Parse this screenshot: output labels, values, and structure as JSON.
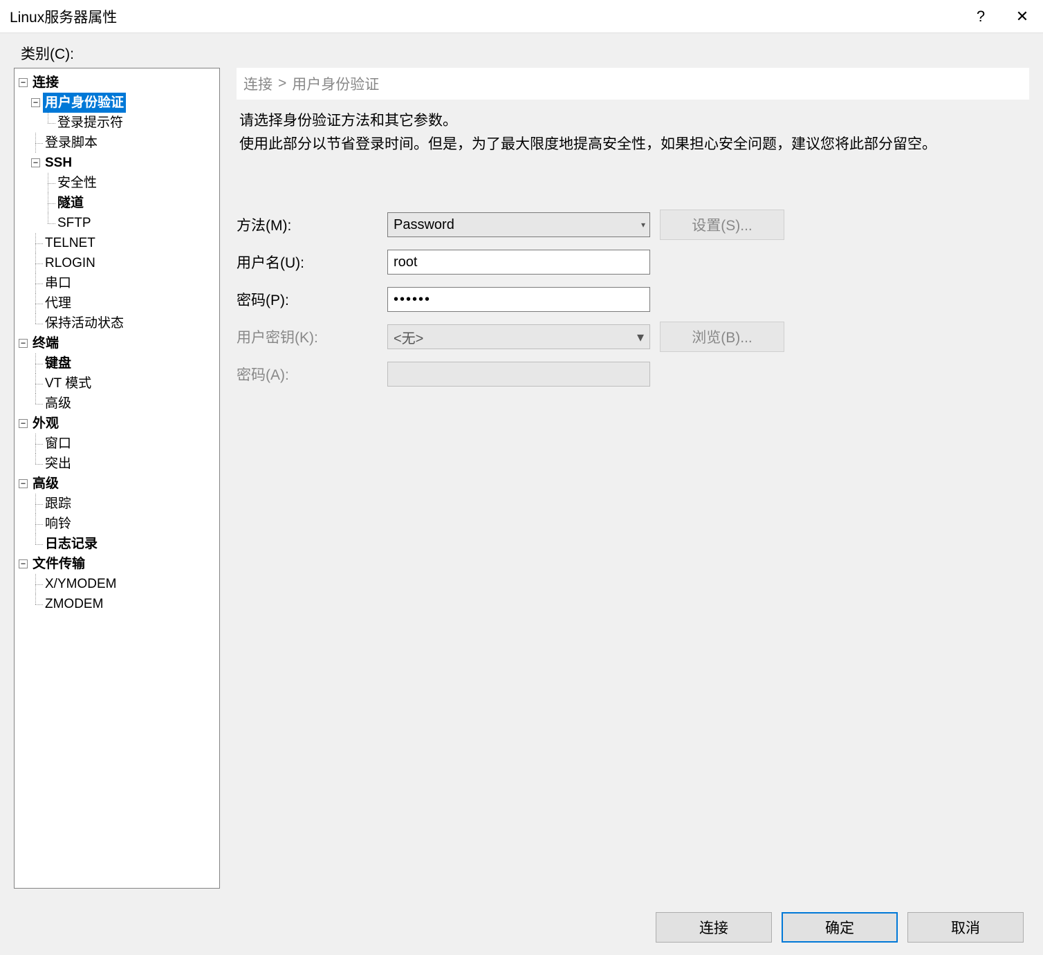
{
  "window": {
    "title": "Linux服务器属性"
  },
  "titlebar": {
    "help": "?",
    "close": "✕"
  },
  "category_label": "类别(C):",
  "tree": {
    "connection": "连接",
    "userauth": "用户身份验证",
    "loginprompt": "登录提示符",
    "loginscript": "登录脚本",
    "ssh": "SSH",
    "security": "安全性",
    "tunnel": "隧道",
    "sftp": "SFTP",
    "telnet": "TELNET",
    "rlogin": "RLOGIN",
    "serial": "串口",
    "proxy": "代理",
    "keepalive": "保持活动状态",
    "terminal": "终端",
    "keyboard": "键盘",
    "vtmode": "VT 模式",
    "advanced1": "高级",
    "appearance": "外观",
    "window": "窗口",
    "highlight": "突出",
    "advanced": "高级",
    "trace": "跟踪",
    "bell": "响铃",
    "logging": "日志记录",
    "filetransfer": "文件传输",
    "xymodem": "X/YMODEM",
    "zmodem": "ZMODEM"
  },
  "breadcrumb": {
    "root": "连接",
    "sep": ">",
    "leaf": "用户身份验证"
  },
  "description": {
    "line1": "请选择身份验证方法和其它参数。",
    "line2": "使用此部分以节省登录时间。但是，为了最大限度地提高安全性，如果担心安全问题，建议您将此部分留空。"
  },
  "form": {
    "method_label": "方法(M):",
    "method_value": "Password",
    "settings_btn": "设置(S)...",
    "username_label": "用户名(U):",
    "username_value": "root",
    "password_label": "密码(P):",
    "password_value": "••••••",
    "userkey_label": "用户密钥(K):",
    "userkey_value": "<无>",
    "browse_btn": "浏览(B)...",
    "passphrase_label": "密码(A):",
    "passphrase_value": ""
  },
  "buttons": {
    "connect": "连接",
    "ok": "确定",
    "cancel": "取消"
  }
}
